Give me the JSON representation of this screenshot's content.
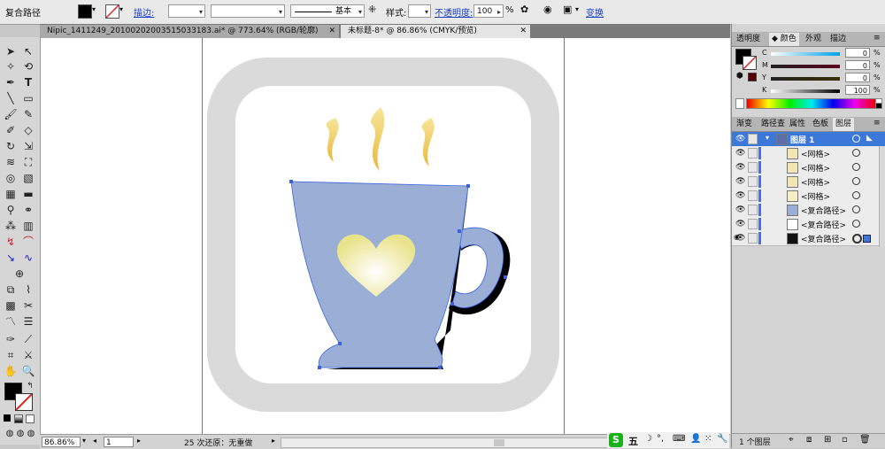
{
  "control_bar": {
    "selection_type": "复合路径",
    "stroke_label": "描边:",
    "stroke_style": "基本",
    "style_label": "样式:",
    "opacity_label": "不透明度:",
    "opacity_value": "100",
    "opacity_unit": "%",
    "transform_label": "变换",
    "fill_color": "#000000",
    "stroke_color": "#ffffff"
  },
  "tabs": [
    {
      "label": "Nipic_1411249_20100202003515033183.ai* @ 773.64% (RGB/轮廓)",
      "active": false
    },
    {
      "label": "未标题-8* @ 86.86% (CMYK/预览)",
      "active": true
    }
  ],
  "status_bar": {
    "zoom": "86.86%",
    "page": "1",
    "undo_text": "25 次还原：无重做"
  },
  "color_panel": {
    "tabs": [
      "透明度",
      "颜色",
      "外观",
      "描边"
    ],
    "active_tab": "颜色",
    "channels": [
      {
        "name": "C",
        "value": "0"
      },
      {
        "name": "M",
        "value": "0"
      },
      {
        "name": "Y",
        "value": "0"
      },
      {
        "name": "K",
        "value": "100"
      }
    ],
    "percent": "%"
  },
  "layers_panel": {
    "tabs": [
      "渐变",
      "路径查",
      "属性",
      "色板",
      "图层"
    ],
    "active_tab": "图层",
    "layers": [
      {
        "name": "图层 1",
        "selected": true,
        "thumb": "#5a6fa8"
      },
      {
        "name": "<网格>",
        "selected": false,
        "thumb": "#f2e6b3"
      },
      {
        "name": "<网格>",
        "selected": false,
        "thumb": "#f2e6b3"
      },
      {
        "name": "<网格>",
        "selected": false,
        "thumb": "#f2e6b3"
      },
      {
        "name": "<网格>",
        "selected": false,
        "thumb": "#f4edc7"
      },
      {
        "name": "<复合路径>",
        "selected": false,
        "thumb": "#9aaed6"
      },
      {
        "name": "<复合路径>",
        "selected": false,
        "thumb": "#ffffff"
      },
      {
        "name": "<复合路径>",
        "selected": false,
        "thumb": "#111111"
      }
    ],
    "footer": "1 个图层"
  },
  "ime_bar": {
    "logo": "S",
    "mode": "五"
  },
  "artwork": {
    "frame_color": "#dadada",
    "cup_color": "#9aaed6",
    "shadow_color": "#000000",
    "heart_color": "#f0eaa0",
    "steam_color": "#f2c94c",
    "path_color": "#3a62e0"
  }
}
